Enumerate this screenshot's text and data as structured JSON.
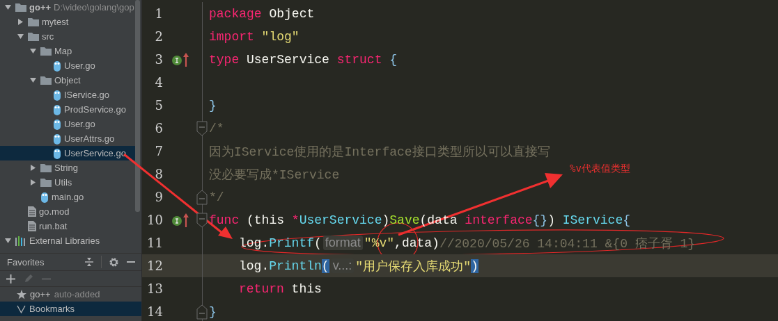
{
  "project_tree": [
    {
      "label": "go++",
      "detail": "D:\\video\\golang\\gop",
      "kind": "folder",
      "expanded": true,
      "selected": false,
      "children": [
        {
          "label": "mytest",
          "kind": "folder",
          "expanded": false,
          "selected": false
        },
        {
          "label": "src",
          "kind": "folder",
          "expanded": true,
          "selected": false,
          "children": [
            {
              "label": "Map",
              "kind": "folder",
              "expanded": true,
              "selected": false,
              "children": [
                {
                  "label": "User.go",
                  "kind": "go",
                  "selected": false
                }
              ]
            },
            {
              "label": "Object",
              "kind": "folder",
              "expanded": true,
              "selected": false,
              "children": [
                {
                  "label": "IService.go",
                  "kind": "go",
                  "selected": false
                },
                {
                  "label": "ProdService.go",
                  "kind": "go",
                  "selected": false
                },
                {
                  "label": "User.go",
                  "kind": "go",
                  "selected": false
                },
                {
                  "label": "UserAttrs.go",
                  "kind": "go",
                  "selected": false
                },
                {
                  "label": "UserService.go",
                  "kind": "go",
                  "selected": true
                }
              ]
            },
            {
              "label": "String",
              "kind": "folder",
              "expanded": false,
              "selected": false
            },
            {
              "label": "Utils",
              "kind": "folder",
              "expanded": false,
              "selected": false
            },
            {
              "label": "main.go",
              "kind": "go",
              "selected": false
            }
          ]
        },
        {
          "label": "go.mod",
          "kind": "file",
          "selected": false
        },
        {
          "label": "run.bat",
          "kind": "file",
          "selected": false
        }
      ]
    },
    {
      "label": "External Libraries",
      "kind": "libs",
      "expanded": true,
      "selected": false
    }
  ],
  "favorites": {
    "title": "Favorites",
    "tools": [
      {
        "kind": "add",
        "disabled": false
      },
      {
        "kind": "edit",
        "disabled": true
      },
      {
        "kind": "remove",
        "disabled": true
      }
    ],
    "items": [
      {
        "kind": "star",
        "label": "go++",
        "detail": "auto-added",
        "selected": false
      },
      {
        "kind": "bookmarks",
        "label": "Bookmarks",
        "selected": true
      }
    ]
  },
  "editor": {
    "lines": [
      {
        "number": "1",
        "current": false,
        "indent": false,
        "tokens": [
          {
            "text": "package",
            "kind": "kw"
          },
          {
            "text": " Object",
            "kind": "plain"
          }
        ]
      },
      {
        "number": "2",
        "current": false,
        "indent": false,
        "tokens": [
          {
            "text": "import",
            "kind": "kw"
          },
          {
            "text": " \"log\"",
            "kind": "str"
          }
        ]
      },
      {
        "number": "3",
        "current": false,
        "indent": false,
        "gutter_icon": {
          "kind": "implements"
        },
        "tokens": [
          {
            "text": "type",
            "kind": "kw"
          },
          {
            "text": " UserService ",
            "kind": "plain"
          },
          {
            "text": "struct",
            "kind": "kw"
          },
          {
            "text": " {",
            "kind": "brace"
          }
        ]
      },
      {
        "number": "4",
        "current": false
      },
      {
        "number": "5",
        "current": false,
        "indent": false,
        "tokens": [
          {
            "text": "}",
            "kind": "brace"
          }
        ]
      },
      {
        "number": "6",
        "current": false,
        "indent": false,
        "fold": {
          "kind": "start"
        },
        "tokens": [
          {
            "text": "/*",
            "kind": "comment"
          }
        ]
      },
      {
        "number": "7",
        "current": false,
        "indent": false,
        "tokens": [
          {
            "text": "因为IService使用的是Interface接口类型所以可以直接写",
            "kind": "comment"
          }
        ]
      },
      {
        "number": "8",
        "current": false,
        "indent": false,
        "tokens": [
          {
            "text": "没必要写成*IService",
            "kind": "comment"
          }
        ]
      },
      {
        "number": "9",
        "current": false,
        "indent": false,
        "fold": {
          "kind": "end"
        },
        "tokens": [
          {
            "text": "*/",
            "kind": "comment"
          }
        ]
      },
      {
        "number": "10",
        "current": false,
        "indent": false,
        "gutter_icon": {
          "kind": "implements"
        },
        "fold": {
          "kind": "start"
        },
        "tokens": [
          {
            "text": "func",
            "kind": "kw"
          },
          {
            "text": " (this ",
            "kind": "plain"
          },
          {
            "text": "*",
            "kind": "kw"
          },
          {
            "text": "UserService",
            "kind": "type"
          },
          {
            "text": ")",
            "kind": "plain"
          },
          {
            "text": "Save",
            "kind": "fn"
          },
          {
            "text": "(data ",
            "kind": "plain"
          },
          {
            "text": "interface",
            "kind": "kw"
          },
          {
            "text": "{}",
            "kind": "brace"
          },
          {
            "text": ") ",
            "kind": "plain"
          },
          {
            "text": "IService",
            "kind": "type"
          },
          {
            "text": "{",
            "kind": "brace"
          }
        ]
      },
      {
        "number": "11",
        "current": false,
        "indent": true,
        "tokens": [
          {
            "text": "log.",
            "kind": "plain"
          },
          {
            "text": "Printf",
            "kind": "type"
          },
          {
            "text": "(",
            "kind": "plain"
          },
          {
            "text": "format",
            "kind": "hint"
          },
          {
            "text": "\"%v\"",
            "kind": "str"
          },
          {
            "text": ",data)",
            "kind": "plain"
          },
          {
            "text": "//2020/05/26 14:04:11 &{0 痞子胥 1}",
            "kind": "comment"
          }
        ]
      },
      {
        "number": "12",
        "current": true,
        "indent": true,
        "tokens": [
          {
            "text": "log.",
            "kind": "plain"
          },
          {
            "text": "Println",
            "kind": "type"
          },
          {
            "text": "(",
            "kind": "match"
          },
          {
            "text": "v...:",
            "kind": "hint"
          },
          {
            "text": "\"用户保存入库成功\"",
            "kind": "str"
          },
          {
            "text": ")",
            "kind": "match"
          }
        ]
      },
      {
        "number": "13",
        "current": false,
        "indent": true,
        "tokens": [
          {
            "text": "return",
            "kind": "kw"
          },
          {
            "text": " this",
            "kind": "plain"
          }
        ]
      },
      {
        "number": "14",
        "current": false,
        "indent": false,
        "fold": {
          "kind": "end"
        },
        "tokens": [
          {
            "text": "}",
            "kind": "brace"
          }
        ]
      }
    ]
  },
  "annotation": {
    "text": "%v代表值类型"
  }
}
